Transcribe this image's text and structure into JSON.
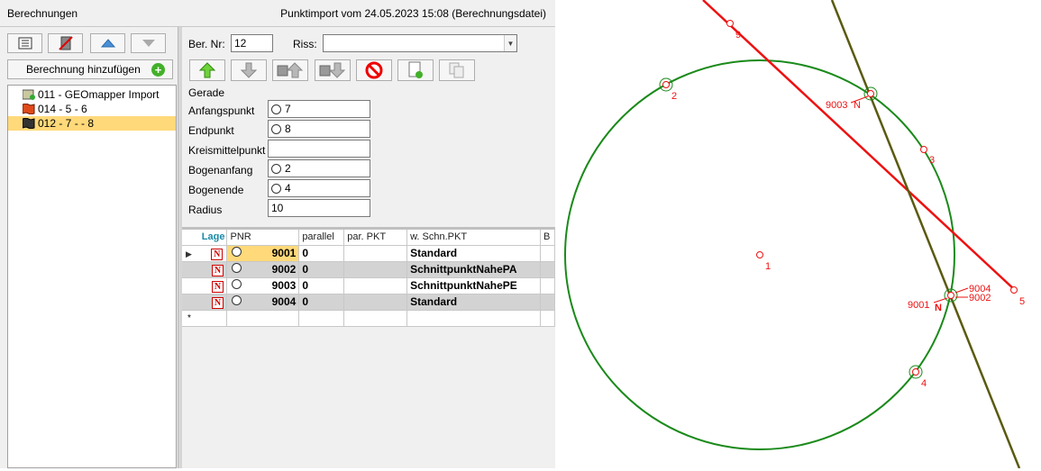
{
  "header": {
    "title": "Berechnungen",
    "import_info": "Punktimport vom 24.05.2023 15:08 (Berechnungsdatei)"
  },
  "nav": {
    "add_button_label": "Berechnung hinzufügen",
    "tree": [
      {
        "label": "011 - GEOmapper Import",
        "selected": false
      },
      {
        "label": "014 - 5 - 6",
        "selected": false
      },
      {
        "label": "012 - 7 -  - 8",
        "selected": true
      }
    ]
  },
  "form": {
    "ber_nr_label": "Ber. Nr:",
    "ber_nr_value": "12",
    "riss_label": "Riss:",
    "riss_value": "",
    "section_label": "Gerade",
    "fields": [
      {
        "label": "Anfangspunkt",
        "value": "7",
        "radio": true
      },
      {
        "label": "Endpunkt",
        "value": "8",
        "radio": true
      },
      {
        "label": "Kreismittelpunkt",
        "value": "",
        "radio": false
      },
      {
        "label": "Bogenanfang",
        "value": "2",
        "radio": true
      },
      {
        "label": "Bogenende",
        "value": "4",
        "radio": true
      },
      {
        "label": "Radius",
        "value": "10",
        "radio": false
      }
    ]
  },
  "grid": {
    "columns": [
      "Lage",
      "PNR",
      "parallel",
      "par. PKT",
      "w. Schn.PKT",
      "B"
    ],
    "rows": [
      {
        "badge": "N",
        "pnr": "9001",
        "parallel": "0",
        "par_pkt": "",
        "schn": "Standard"
      },
      {
        "badge": "N",
        "pnr": "9002",
        "parallel": "0",
        "par_pkt": "",
        "schn": "SchnittpunktNahePA"
      },
      {
        "badge": "N",
        "pnr": "9003",
        "parallel": "0",
        "par_pkt": "",
        "schn": "SchnittpunktNahePE"
      },
      {
        "badge": "N",
        "pnr": "9004",
        "parallel": "0",
        "par_pkt": "",
        "schn": "Standard"
      }
    ],
    "new_row_marker": "*"
  },
  "map": {
    "colors": {
      "circle": "#1a8a1a",
      "line_red": "#ee1111",
      "line_olive": "#5a5a10",
      "label": "#ee1111"
    },
    "labels": {
      "p1": "1",
      "p2": "2",
      "p3": "3",
      "p4": "4",
      "p5": "5",
      "p9": "9",
      "p9001": "9001",
      "p9002": "9002",
      "p9003": "9003",
      "p9004": "9004",
      "n_a": "N",
      "n_b": "N"
    }
  }
}
